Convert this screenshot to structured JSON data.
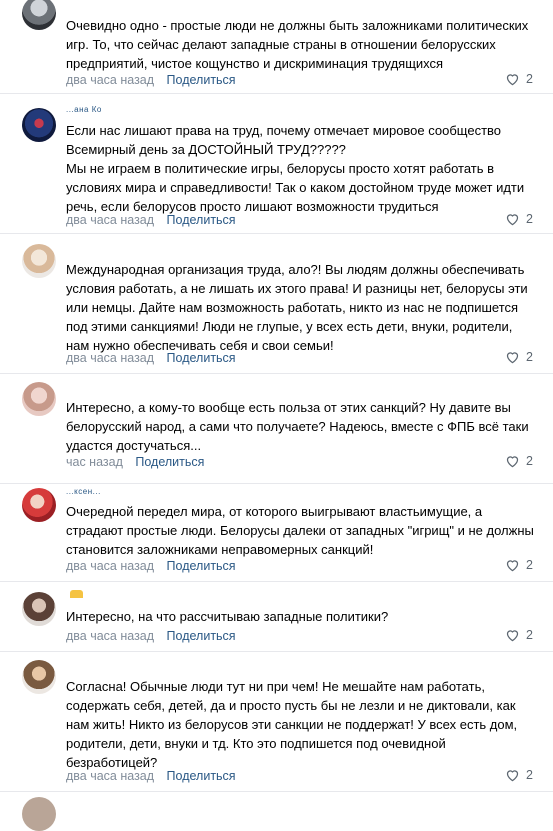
{
  "ui": {
    "share_label": "Поделиться",
    "like_icon": "heart-icon"
  },
  "comments": [
    {
      "author": "",
      "text": "Очевидно одно - простые люди не должны быть заложниками политических игр. То, что сейчас делают западные страны в отношении белорусских предприятий, чистое кощунство и дискриминация трудящихся",
      "time": "два часа назад",
      "likes": "2"
    },
    {
      "author": "...ана Ко",
      "text": "Если нас лишают права на труд, почему отмечает мировое сообщество Всемирный день за ДОСТОЙНЫЙ ТРУД?????\nМы не играем в политические игры, белорусы просто хотят работать в условиях мира и справедливости! Так о каком достойном труде может идти речь, если белорусов просто лишают возможности трудиться",
      "time": "два часа назад",
      "likes": "2"
    },
    {
      "author": "",
      "text": "Международная организация труда, ало?! Вы людям должны обеспечивать условия работать, а не лишать их этого права! И разницы нет, белорусы эти или немцы. Дайте нам возможность работать, никто из нас не подпишется под этими санкциями! Люди не глупые, у всех есть дети, внуки, родители, нам нужно обеспечивать себя и свои семьи!",
      "time": "два часа назад",
      "likes": "2"
    },
    {
      "author": "",
      "text": "Интересно, а кому-то вообще есть польза от этих санкций? Ну давите вы белорусский народ, а сами что получаете? Надеюсь, вместе с ФПБ всё таки удастся достучаться...",
      "time": "час назад",
      "likes": "2"
    },
    {
      "author": "...ксен...",
      "text": "Очередной передел мира, от которого выигрывают властьимущие, а страдают простые люди. Белорусы далеки от западных \"игрищ\" и не должны становится заложниками неправомерных санкций!",
      "time": "два часа назад",
      "likes": "2"
    },
    {
      "author": "",
      "text": "Интересно, на что рассчитываю западные политики?",
      "time": "два часа назад",
      "likes": "2"
    },
    {
      "author": "",
      "text": "Согласна! Обычные люди тут ни при чем! Не мешайте нам работать, содержать себя, детей, да и просто пусть бы не лезли и не диктовали, как нам жить! Никто из белорусов эти санкции не поддержат! У всех есть дом, родители, дети, внуки и тд. Кто это подпишется под очевидной безработицей?",
      "time": "два часа назад",
      "likes": "2"
    }
  ]
}
